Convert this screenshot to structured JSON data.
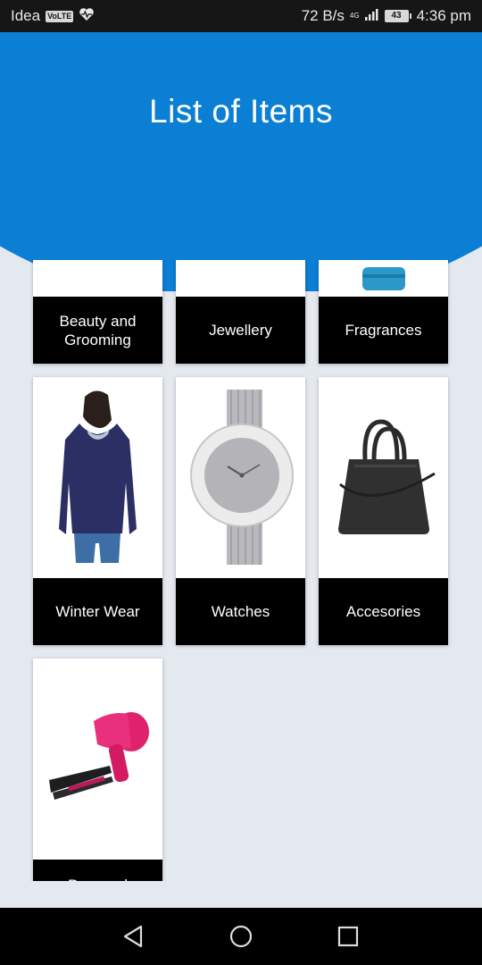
{
  "status_bar": {
    "carrier": "Idea",
    "volte": "VoLTE",
    "speed": "72 B/s",
    "network": "4G",
    "battery": "43",
    "time": "4:36 pm"
  },
  "header": {
    "title": "List of Items",
    "color": "#0a7fd4"
  },
  "categories": [
    {
      "label": "Beauty and Grooming",
      "icon": "beauty-product-icon"
    },
    {
      "label": "Jewellery",
      "icon": "jewellery-icon"
    },
    {
      "label": "Fragrances",
      "icon": "perfume-bottle-icon"
    },
    {
      "label": "Winter Wear",
      "icon": "hoodie-image"
    },
    {
      "label": "Watches",
      "icon": "watch-image"
    },
    {
      "label": "Accesories",
      "icon": "handbag-image"
    },
    {
      "label": "Personal",
      "icon": "hair-dryer-straightener-image"
    }
  ],
  "nav": {
    "back": "back-icon",
    "home": "home-icon",
    "recents": "recents-icon"
  }
}
